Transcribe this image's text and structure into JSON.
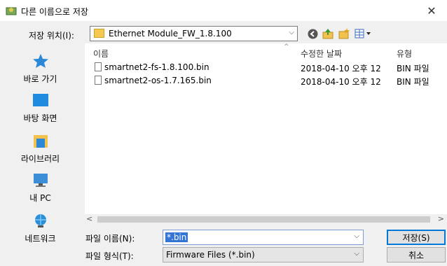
{
  "window": {
    "title": "다른 이름으로 저장",
    "close_glyph": "✕"
  },
  "location": {
    "label": "저장 위치(I):",
    "value": "Ethernet Module_FW_1.8.100",
    "dropdown_glyph": "⌵"
  },
  "toolbar": {
    "icons": [
      "back-icon",
      "up-folder-icon",
      "new-folder-icon",
      "view-menu-icon"
    ]
  },
  "places": [
    {
      "label": "바로 가기",
      "icon": "quick-access-icon"
    },
    {
      "label": "바탕 화면",
      "icon": "desktop-icon"
    },
    {
      "label": "라이브러리",
      "icon": "libraries-icon"
    },
    {
      "label": "내 PC",
      "icon": "this-pc-icon"
    },
    {
      "label": "네트워크",
      "icon": "network-icon"
    }
  ],
  "file_list": {
    "columns": [
      "이름",
      "수정한 날짜",
      "유형"
    ],
    "rows": [
      {
        "name": "smartnet2-fs-1.8.100.bin",
        "date": "2018-04-10 오후 12",
        "type": "BIN 파일"
      },
      {
        "name": "smartnet2-os-1.7.165.bin",
        "date": "2018-04-10 오후 12",
        "type": "BIN 파일"
      }
    ]
  },
  "filename": {
    "label": "파일 이름(N):",
    "value": "*.bin"
  },
  "filetype": {
    "label": "파일 형식(T):",
    "value": "Firmware Files (*.bin)"
  },
  "buttons": {
    "save": "저장(S)",
    "cancel": "취소"
  },
  "colors": {
    "selection": "#3375d7",
    "accent": "#0078d7"
  }
}
